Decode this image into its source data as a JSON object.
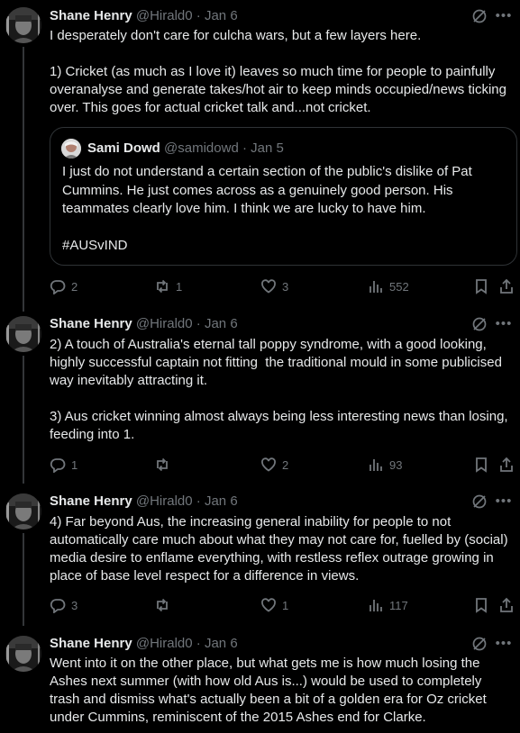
{
  "author": {
    "name": "Shane Henry",
    "handle": "@Hirald0"
  },
  "tweets": [
    {
      "date": "Jan 6",
      "text": "I desperately don't care for culcha wars, but a few layers here.\n\n1) Cricket (as much as I love it) leaves so much time for people to painfully overanalyse and generate takes/hot air to keep minds occupied/news ticking over. This goes for actual cricket talk and...not cricket.",
      "quote": {
        "name": "Sami Dowd",
        "handle": "@samidowd",
        "date": "Jan 5",
        "text": "I just do not understand a certain section of the public's dislike of Pat Cummins. He just comes across as a genuinely good person. His teammates clearly love him. I think we are lucky to have him.\n\n#AUSvIND"
      },
      "replies": "2",
      "reposts": "1",
      "likes": "3",
      "views": "552"
    },
    {
      "date": "Jan 6",
      "text": "2) A touch of Australia's eternal tall poppy syndrome, with a good looking, highly successful captain not fitting  the traditional mould in some publicised way inevitably attracting it.\n\n3) Aus cricket winning almost always being less interesting news than losing, feeding into 1.",
      "replies": "1",
      "reposts": "",
      "likes": "2",
      "views": "93"
    },
    {
      "date": "Jan 6",
      "text": "4) Far beyond Aus, the increasing general inability for people to not automatically care much about what they may not care for, fuelled by (social) media desire to enflame everything, with restless reflex outrage growing in place of base level respect for a difference in views.",
      "replies": "3",
      "reposts": "",
      "likes": "1",
      "views": "117"
    },
    {
      "date": "Jan 6",
      "text": "Went into it on the other place, but what gets me is how much losing the Ashes next summer (with how old Aus is...) would be used to completely trash and dismiss what's actually been a bit of a golden era for Oz cricket under Cummins, reminiscent of the 2015 Ashes end for Clarke."
    }
  ],
  "separator": "·",
  "more_label": "•••"
}
